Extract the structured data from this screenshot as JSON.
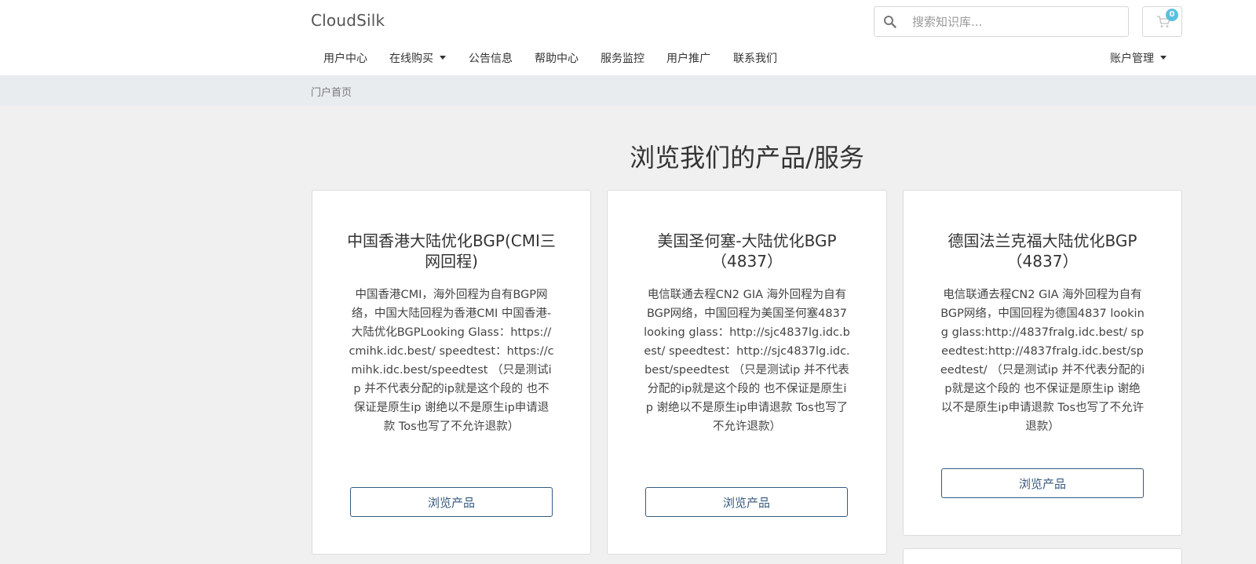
{
  "header": {
    "brand": "CloudSilk",
    "search": {
      "placeholder": "搜索知识库..."
    },
    "cart": {
      "count": "0"
    }
  },
  "nav": {
    "items": [
      {
        "label": "用户中心"
      },
      {
        "label": "在线购买",
        "dropdown": true
      },
      {
        "label": "公告信息"
      },
      {
        "label": "帮助中心"
      },
      {
        "label": "服务监控"
      },
      {
        "label": "用户推广"
      },
      {
        "label": "联系我们"
      }
    ],
    "account": {
      "label": "账户管理",
      "dropdown": true
    }
  },
  "breadcrumb": {
    "home": "门户首页"
  },
  "main": {
    "title": "浏览我们的产品/服务",
    "cards": [
      {
        "title": "中国香港大陆优化BGP(CMI三网回程)",
        "description": "中国香港CMI，海外回程为自有BGP网络，中国大陆回程为香港CMI 中国香港-大陆优化BGPLooking Glass：https://cmihk.idc.best/ speedtest：https://cmihk.idc.best/speedtest （只是测试ip 并不代表分配的ip就是这个段的 也不保证是原生ip 谢绝以不是原生ip申请退款 Tos也写了不允许退款）",
        "button": "浏览产品"
      },
      {
        "title": "美国圣何塞-大陆优化BGP（4837）",
        "description": "电信联通去程CN2 GIA 海外回程为自有BGP网络，中国回程为美国圣何塞4837 looking glass：http://sjc4837lg.idc.best/ speedtest：http://sjc4837lg.idc.best/speedtest （只是测试ip 并不代表分配的ip就是这个段的 也不保证是原生ip 谢绝以不是原生ip申请退款 Tos也写了不允许退款）",
        "button": "浏览产品"
      },
      {
        "title": "德国法兰克福大陆优化BGP（4837）",
        "description": "电信联通去程CN2 GIA 海外回程为自有BGP网络，中国回程为德国4837 looking glass:http://4837fralg.idc.best/ speedtest:http://4837fralg.idc.best/speedtest/ （只是测试ip 并不代表分配的ip就是这个段的 也不保证是原生ip 谢绝以不是原生ip申请退款 Tos也写了不允许退款）",
        "button": "浏览产品"
      }
    ]
  },
  "colors": {
    "accent": "#375a7f",
    "badge": "#5bc0de",
    "page_bg": "#f0f0f0",
    "breadcrumb_bg": "#e9ecef"
  },
  "icons": {
    "search": "search-icon",
    "cart": "cart-icon",
    "caret": "caret-down-icon"
  }
}
